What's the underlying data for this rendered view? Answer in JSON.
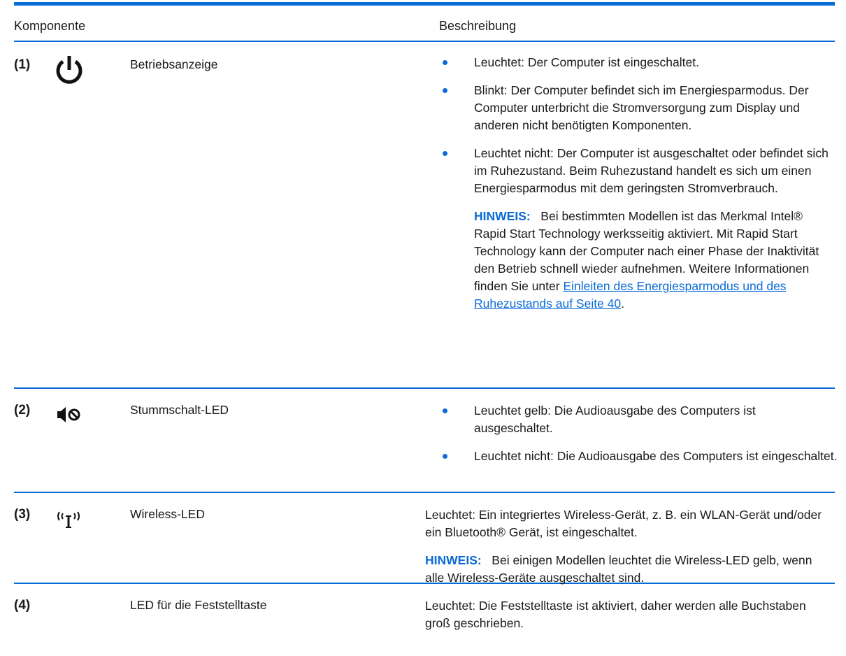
{
  "header": {
    "col_component": "Komponente",
    "col_description": "Beschreibung"
  },
  "rows": [
    {
      "num": "(1)",
      "icon": "power-icon",
      "name": "Betriebsanzeige",
      "bullets": [
        "Leuchtet: Der Computer ist eingeschaltet.",
        "Blinkt: Der Computer befindet sich im Energiesparmodus. Der Computer unterbricht die Stromversorgung zum Display und anderen nicht benötigten Komponenten.",
        "Leuchtet nicht: Der Computer ist ausgeschaltet oder befindet sich im Ruhezustand. Beim Ruhezustand handelt es sich um einen Energiesparmodus mit dem geringsten Stromverbrauch."
      ],
      "note_label": "HINWEIS:",
      "note_text": "Bei bestimmten Modellen ist das Merkmal Intel® Rapid Start Technology werksseitig aktiviert. Mit Rapid Start Technology kann der Computer nach einer Phase der Inaktivität den Betrieb schnell wieder aufnehmen. Weitere Informationen finden Sie unter",
      "note_link": "Einleiten des Energiesparmodus und des Ruhezustands auf Seite 40",
      "note_end": "."
    },
    {
      "num": "(2)",
      "icon": "mute-icon",
      "name": "Stummschalt-LED",
      "bullets": [
        "Leuchtet gelb: Die Audioausgabe des Computers ist ausgeschaltet.",
        "Leuchtet nicht: Die Audioausgabe des Computers ist eingeschaltet."
      ]
    },
    {
      "num": "(3)",
      "icon": "wireless-icon",
      "name": "Wireless-LED",
      "text": "Leuchtet: Ein integriertes Wireless-Gerät, z. B. ein WLAN-Gerät und/oder ein Bluetooth® Gerät, ist eingeschaltet.",
      "note_label": "HINWEIS:",
      "note_text": "Bei einigen Modellen leuchtet die Wireless-LED gelb, wenn alle Wireless-Geräte ausgeschaltet sind."
    },
    {
      "num": "(4)",
      "name": "LED für die Feststelltaste",
      "text": "Leuchtet: Die Feststelltaste ist aktiviert, daher werden alle Buchstaben groß geschrieben."
    }
  ],
  "colors": {
    "accent": "#0a6bd6"
  }
}
